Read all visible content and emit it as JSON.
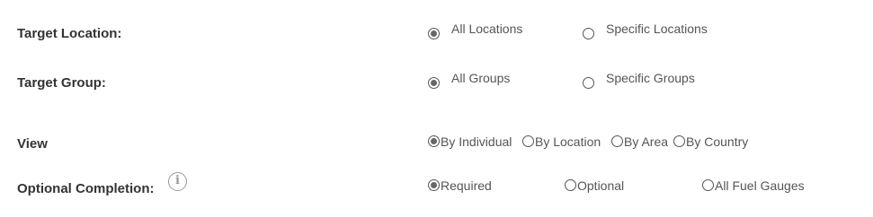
{
  "target_location": {
    "label": "Target Location:",
    "options": [
      {
        "label": "All Locations",
        "checked": true
      },
      {
        "label": "Specific Locations",
        "checked": false
      }
    ]
  },
  "target_group": {
    "label": "Target Group:",
    "options": [
      {
        "label": "All Groups",
        "checked": true
      },
      {
        "label": "Specific Groups",
        "checked": false
      }
    ]
  },
  "view": {
    "label": "View",
    "options": [
      {
        "label": "By Individual",
        "checked": true
      },
      {
        "label": "By Location",
        "checked": false
      },
      {
        "label": "By Area",
        "checked": false
      },
      {
        "label": "By Country",
        "checked": false
      }
    ]
  },
  "optional_completion": {
    "label": "Optional Completion:",
    "info_icon": "info-icon",
    "options": [
      {
        "label": "Required",
        "checked": true
      },
      {
        "label": "Optional",
        "checked": false
      },
      {
        "label": "All Fuel Gauges",
        "checked": false
      }
    ]
  }
}
